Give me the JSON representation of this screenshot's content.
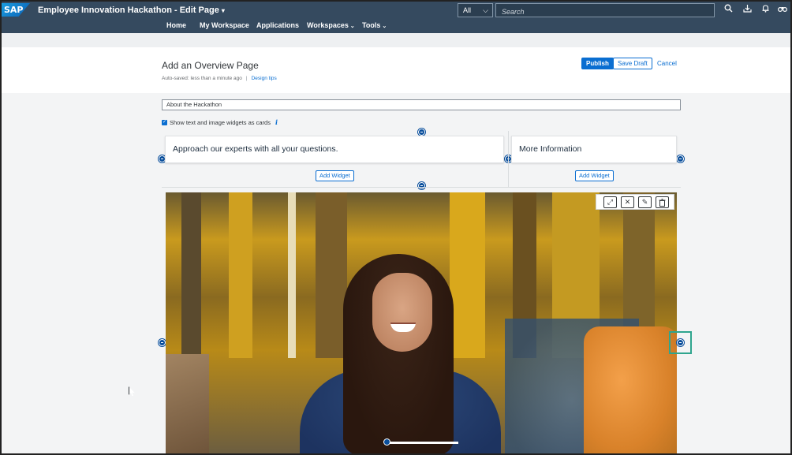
{
  "shell": {
    "logo": "SAP",
    "title": "Employee Innovation Hackathon - Edit Page",
    "title_caret": "▾",
    "scope": "All",
    "scope_chevron": "⌵",
    "search_placeholder": "Search",
    "icons": [
      "search-icon",
      "download-icon",
      "bell-icon",
      "binoculars-icon"
    ]
  },
  "nav": {
    "items": [
      "Home",
      "My Workspace",
      "Applications",
      "Workspaces",
      "Tools"
    ],
    "caret": "⌄"
  },
  "header": {
    "page_title": "Add an Overview Page",
    "autosave": "Auto-saved: less than a minute ago",
    "separator": "|",
    "design_tips": "Design tips",
    "publish": "Publish",
    "save_draft": "Save Draft",
    "cancel": "Cancel"
  },
  "editor": {
    "section_title_value": "About the Hackathon",
    "show_cards_label": "Show text and image widgets as cards",
    "checked": true,
    "info_glyph": "i",
    "cards": [
      "Approach our experts with all your questions.",
      "More Information"
    ],
    "add_widget": "Add Widget"
  },
  "image_widget": {
    "toolbar": [
      "expand-icon",
      "close-icon",
      "edit-icon",
      "delete-icon"
    ],
    "toolbar_glyphs": [
      "⤢",
      "✕",
      "✎",
      "🗑"
    ]
  },
  "colors": {
    "shell": "#354a5f",
    "accent": "#0a6ed1",
    "highlight": "#2fa58e"
  }
}
